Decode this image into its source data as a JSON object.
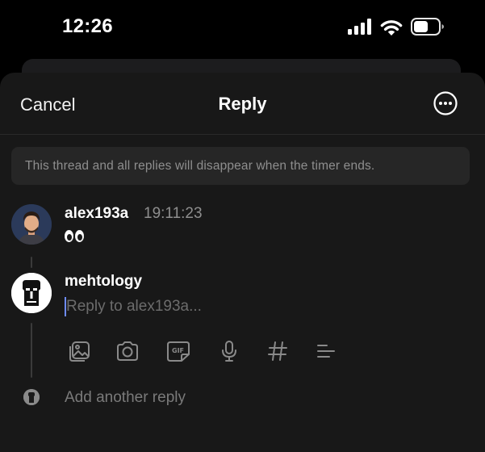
{
  "status_bar": {
    "time": "12:26",
    "icons": [
      "cellular-signal-icon",
      "wifi-icon",
      "battery-icon"
    ]
  },
  "nav": {
    "cancel_label": "Cancel",
    "title": "Reply",
    "more_icon": "ellipsis-circle-icon"
  },
  "notice": {
    "text": "This thread and all replies will disappear when the timer ends."
  },
  "original_post": {
    "username": "alex193a",
    "timestamp": "19:11:23",
    "content": "eyes-emoji",
    "avatar": "avatar-alex193a"
  },
  "reply_composer": {
    "username": "mehtology",
    "placeholder": "Reply to alex193a...",
    "value": "",
    "avatar": "avatar-mehtology"
  },
  "toolbar": {
    "items": [
      "gallery-icon",
      "camera-icon",
      "gif-icon",
      "microphone-icon",
      "hashtag-icon",
      "poll-list-icon"
    ]
  },
  "add_another": {
    "label": "Add another reply"
  },
  "colors": {
    "background": "#000000",
    "sheet": "#181818",
    "notice_bg": "#262626",
    "text_primary": "#f2f2f2",
    "text_secondary": "#8e8e8e",
    "cursor": "#6e8cff"
  }
}
